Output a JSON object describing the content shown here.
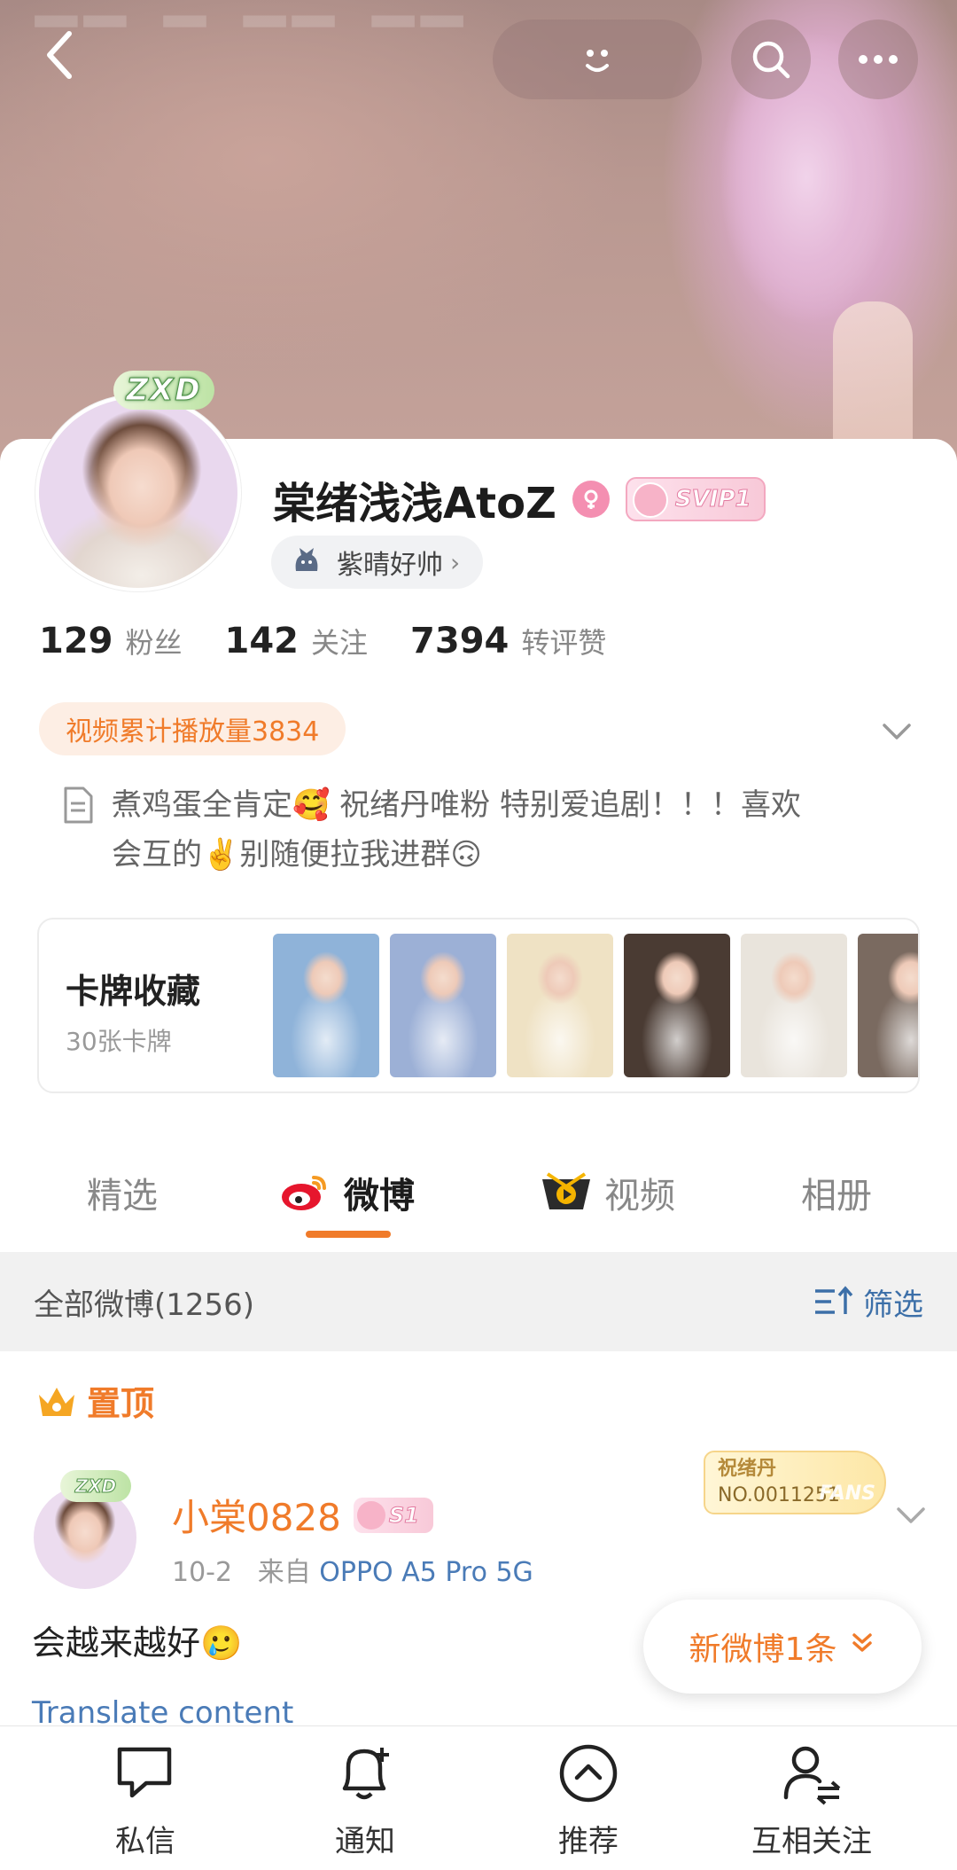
{
  "profile": {
    "username": "棠绪浅浅AtoZ",
    "svip_badge": "SVIP1",
    "avatar_frame_text": "ZXD",
    "tag_label": "紫晴好帅",
    "stats": [
      {
        "value": "129",
        "label": "粉丝"
      },
      {
        "value": "142",
        "label": "关注"
      },
      {
        "value": "7394",
        "label": "转评赞"
      }
    ],
    "video_plays": "视频累计播放量3834",
    "bio_line1": "煮鸡蛋全肯定🥰 祝绪丹唯粉 特别爱追剧！！！喜欢",
    "bio_line2": "会互的✌️别随便拉我进群🙃"
  },
  "collection": {
    "title": "卡牌收藏",
    "subtitle": "30张卡牌",
    "thumb_colors": [
      "#8fb3d9",
      "#9cb0d6",
      "#efe2c4",
      "#4a3b33",
      "#e9e4dc",
      "#7a6a60"
    ]
  },
  "tabs": [
    {
      "label": "精选",
      "active": false
    },
    {
      "label": "微博",
      "active": true
    },
    {
      "label": "视频",
      "active": false
    },
    {
      "label": "相册",
      "active": false
    }
  ],
  "filter": {
    "all_label": "全部微博(1256)",
    "filter_label": "筛选"
  },
  "pinned_label": "置顶",
  "post": {
    "author": "小棠0828",
    "badge": "S1",
    "avatar_frame_text": "ZXD",
    "date": "10-2",
    "source_prefix": "来自",
    "source": "OPPO A5 Pro 5G",
    "fans_line1": "祝绪丹",
    "fans_line2": "NO.0011251",
    "fans_watermark": "FANS",
    "text": "会越来越好🥲",
    "translate": "Translate content"
  },
  "new_post_toast": "新微博1条",
  "bottom_bar": [
    {
      "label": "私信",
      "icon": "message-icon"
    },
    {
      "label": "通知",
      "icon": "bell-icon"
    },
    {
      "label": "推荐",
      "icon": "recommend-icon"
    },
    {
      "label": "互相关注",
      "icon": "mutual-follow-icon"
    }
  ],
  "colors": {
    "accent": "#f07b2a",
    "link": "#4a7bb7",
    "svip_pink": "#f8c9d8"
  }
}
